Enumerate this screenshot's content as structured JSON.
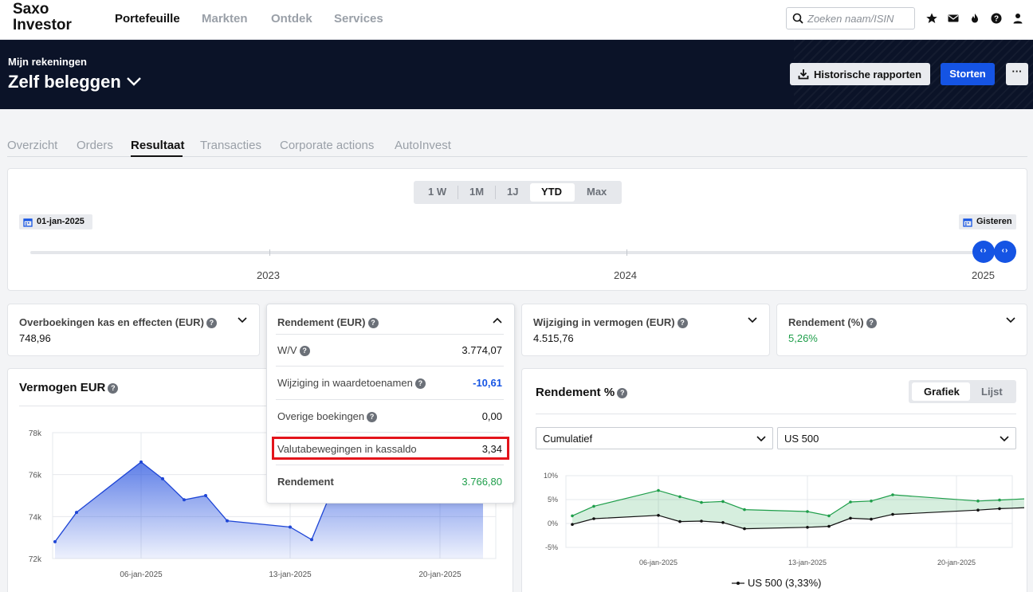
{
  "brand": {
    "line1": "Saxo",
    "line2": "Investor"
  },
  "nav": {
    "items": [
      "Portefeuille",
      "Markten",
      "Ontdek",
      "Services"
    ]
  },
  "search": {
    "placeholder": "Zoeken naam/ISIN"
  },
  "top_icons": [
    "star-icon",
    "mail-icon",
    "flame-icon",
    "help-icon",
    "user-icon"
  ],
  "account": {
    "subtitle": "Mijn rekeningen",
    "title": "Zelf beleggen",
    "hist_button": "Historische rapporten",
    "deposit_button": "Storten",
    "more_button": "···"
  },
  "tabs": [
    "Overzicht",
    "Orders",
    "Resultaat",
    "Transacties",
    "Corporate actions",
    "AutoInvest"
  ],
  "active_tab": "Resultaat",
  "period": {
    "options": [
      "1 W",
      "1M",
      "1J",
      "YTD",
      "Max"
    ],
    "selected": "YTD",
    "start_date": "01-jan-2025",
    "end_date": "Gisteren",
    "years": [
      "2023",
      "2024",
      "2025"
    ]
  },
  "stats": {
    "transfers": {
      "title": "Overboekingen kas en effecten (EUR)",
      "value": "748,96"
    },
    "return_eur": {
      "title": "Rendement (EUR)"
    },
    "change": {
      "title": "Wijziging in vermogen (EUR)",
      "value": "4.515,76"
    },
    "return_pct": {
      "title": "Rendement (%)",
      "value": "5,26%"
    }
  },
  "return_breakdown": {
    "rows": [
      {
        "label": "W/V",
        "value": "3.774,07"
      },
      {
        "label": "Wijziging in waardetoenamen",
        "value": "-10,61"
      },
      {
        "label": "Overige boekingen",
        "value": "0,00"
      },
      {
        "label": "Valutabewegingen in kassaldo",
        "value": "3,34"
      }
    ],
    "total_label": "Rendement",
    "total_value": "3.766,80"
  },
  "colors": {
    "accent": "#1554e4",
    "positive": "#1e9e4a",
    "negative": "#1554e4",
    "navy": "#0b1328",
    "highlight": "#e3141b"
  },
  "wealth_chart": {
    "title": "Vermogen EUR",
    "chart_data": {
      "type": "area",
      "y_ticks": [
        "78k",
        "76k",
        "74k",
        "72k"
      ],
      "ylim": [
        72000,
        78000
      ],
      "x_ticks": [
        "06-jan-2025",
        "13-jan-2025",
        "20-jan-2025"
      ],
      "x": [
        "02-jan",
        "03-jan",
        "06-jan",
        "07-jan",
        "08-jan",
        "09-jan",
        "10-jan",
        "13-jan",
        "14-jan",
        "15-jan"
      ],
      "values": [
        72800,
        74200,
        76600,
        75800,
        74800,
        75000,
        73800,
        73500,
        72900,
        75400
      ]
    }
  },
  "return_chart": {
    "title": "Rendement %",
    "view_options": [
      "Grafiek",
      "Lijst"
    ],
    "view_selected": "Grafiek",
    "mode_select": "Cumulatief",
    "benchmark_select": "US 500",
    "legend_label": "US 500 (3,33%)",
    "chart_data": {
      "type": "line",
      "y_ticks": [
        "10%",
        "5%",
        "0%",
        "-5%"
      ],
      "ylim": [
        -5,
        10
      ],
      "x_ticks": [
        "06-jan-2025",
        "13-jan-2025",
        "20-jan-2025"
      ],
      "series": [
        {
          "values": [
            1.6,
            3.6,
            6.9,
            5.6,
            4.4,
            4.6,
            2.9,
            2.5,
            1.6,
            4.5,
            4.7,
            6.0,
            4.7,
            4.9,
            5.3
          ]
        },
        {
          "name": "US 500 (3,33%)",
          "values": [
            -0.2,
            1.0,
            1.7,
            0.4,
            0.5,
            0.2,
            -1.1,
            -0.8,
            -0.6,
            1.1,
            0.9,
            1.9,
            2.8,
            3.1,
            3.4
          ]
        }
      ]
    }
  }
}
